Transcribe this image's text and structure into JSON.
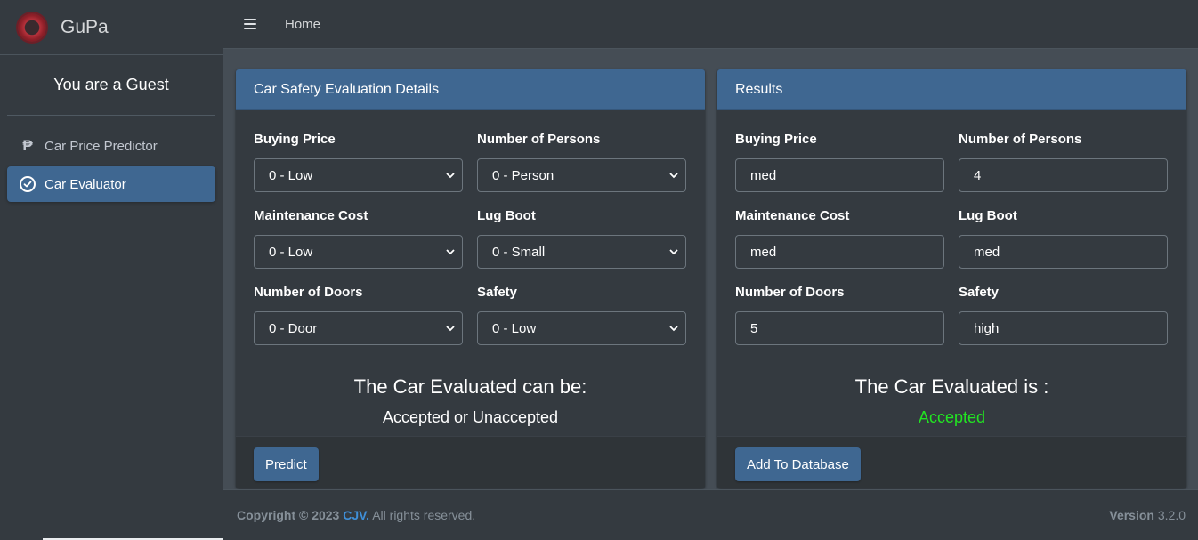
{
  "brand": {
    "name": "GuPa"
  },
  "user": {
    "label": "You are a Guest"
  },
  "sidebar": {
    "items": [
      {
        "label": "Car Price Predictor",
        "icon": "peso-icon"
      },
      {
        "label": "Car Evaluator",
        "icon": "check-circle-icon",
        "active": true
      }
    ]
  },
  "topbar": {
    "home_label": "Home"
  },
  "details": {
    "title": "Car Safety Evaluation Details",
    "fields": {
      "buying_price": {
        "label": "Buying Price",
        "value": "0 - Low"
      },
      "persons": {
        "label": "Number of Persons",
        "value": "0 - Person"
      },
      "maintenance": {
        "label": "Maintenance Cost",
        "value": "0 - Low"
      },
      "lug_boot": {
        "label": "Lug Boot",
        "value": "0 - Small"
      },
      "doors": {
        "label": "Number of Doors",
        "value": "0 - Door"
      },
      "safety": {
        "label": "Safety",
        "value": "0 - Low"
      }
    },
    "result_title": "The Car Evaluated can be:",
    "result_text": "Accepted or Unaccepted",
    "button": "Predict"
  },
  "results": {
    "title": "Results",
    "fields": {
      "buying_price": {
        "label": "Buying Price",
        "value": "med"
      },
      "persons": {
        "label": "Number of Persons",
        "value": "4"
      },
      "maintenance": {
        "label": "Maintenance Cost",
        "value": "med"
      },
      "lug_boot": {
        "label": "Lug Boot",
        "value": "med"
      },
      "doors": {
        "label": "Number of Doors",
        "value": "5"
      },
      "safety": {
        "label": "Safety",
        "value": "high"
      }
    },
    "result_title": "The Car Evaluated is :",
    "result_text": "Accepted",
    "result_color": "#22e422",
    "button": "Add To Database"
  },
  "footer": {
    "copyright_prefix": "Copyright © 2023",
    "company": "CJV.",
    "rights": "All rights reserved.",
    "version_label": "Version",
    "version_number": "3.2.0"
  },
  "colors": {
    "accent": "#3f6791",
    "sidebar_bg": "#343a40",
    "content_bg": "#454d55",
    "link": "#3f8fd8"
  }
}
